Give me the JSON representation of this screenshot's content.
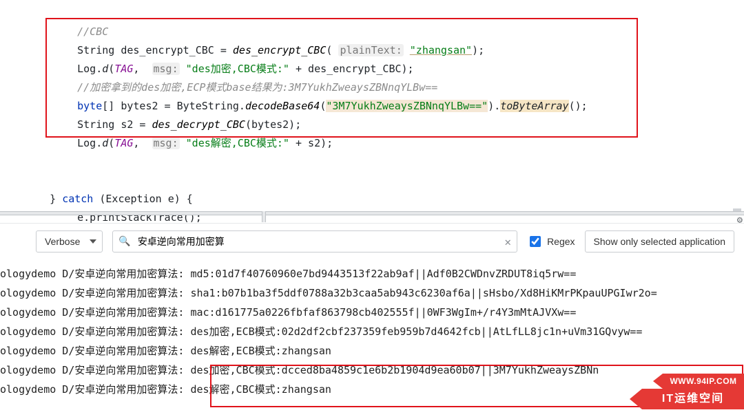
{
  "icons": {
    "search": "🔍",
    "clear": "✕",
    "gear": "⚙"
  },
  "code": {
    "c_cbc": "//CBC",
    "l1_a": "String des_encrypt_CBC = ",
    "l1_fn": "des_encrypt_CBC",
    "l1_hint": "plainText:",
    "l1_str": "\"zhangsan\"",
    "l1_end": ");",
    "l2_a": "Log.",
    "l2_d": "d",
    "l2_open": "(",
    "l2_tag": "TAG",
    "l2_comma": ",  ",
    "l2_hint": "msg:",
    "l2_str": "\"des加密,CBC模式:\"",
    "l2_plus": " + des_encrypt_CBC);",
    "l3_comment": "//加密拿到的des加密,ECP模式base结果为:3M7YukhZweaysZBNnqYLBw==",
    "l4_a": "byte",
    "l4_b": "[] bytes2 = ByteString.",
    "l4_fn": "decodeBase64",
    "l4_open": "(",
    "l4_str": "\"3M7YukhZweaysZBNnqYLBw==\"",
    "l4_close": ").",
    "l4_hl": "toByteArray",
    "l4_end": "();",
    "l5_a": "String s2 = ",
    "l5_fn": "des_decrypt_CBC",
    "l5_b": "(bytes2);",
    "l6_a": "Log.",
    "l6_d": "d",
    "l6_open": "(",
    "l6_tag": "TAG",
    "l6_comma": ",  ",
    "l6_hint": "msg:",
    "l6_str": "\"des解密,CBC模式:\"",
    "l6_b": " + s2);",
    "l7": "} ",
    "l7_kw": "catch",
    "l7_b": " (Exception e) {",
    "l8": "e.printStackTrace();"
  },
  "toolbar": {
    "level": "Verbose",
    "search_value": "安卓逆向常用加密算",
    "regex_label": "Regex",
    "regex_checked": true,
    "filter": "Show only selected application"
  },
  "log": {
    "prefix": "ologydemo D/安卓逆向常用加密算法: ",
    "lines": [
      "md5:01d7f40760960e7bd9443513f22ab9af||Adf0B2CWDnvZRDUT8iq5rw==",
      "sha1:b07b1ba3f5ddf0788a32b3caa5ab943c6230af6a||sHsbo/Xd8HiKMrPKpauUPGIwr2o=",
      "mac:d161775a0226fbfaf863798cb402555f||0WF3WgIm+/r4Y3mMtAJVXw==",
      "des加密,ECB模式:02d2df2cbf237359feb959b7d4642fcb||AtLfLL8jc1n+uVm31GQvyw==",
      "des解密,ECB模式:zhangsan",
      "des加密,CBC模式:dcced8ba4859c1e6b2b1904d9ea60b07||3M7YukhZweaysZBNn",
      "des解密,CBC模式:zhangsan"
    ]
  },
  "watermark": {
    "top": "WWW.94IP.COM",
    "bottom": "IT运维空间"
  }
}
